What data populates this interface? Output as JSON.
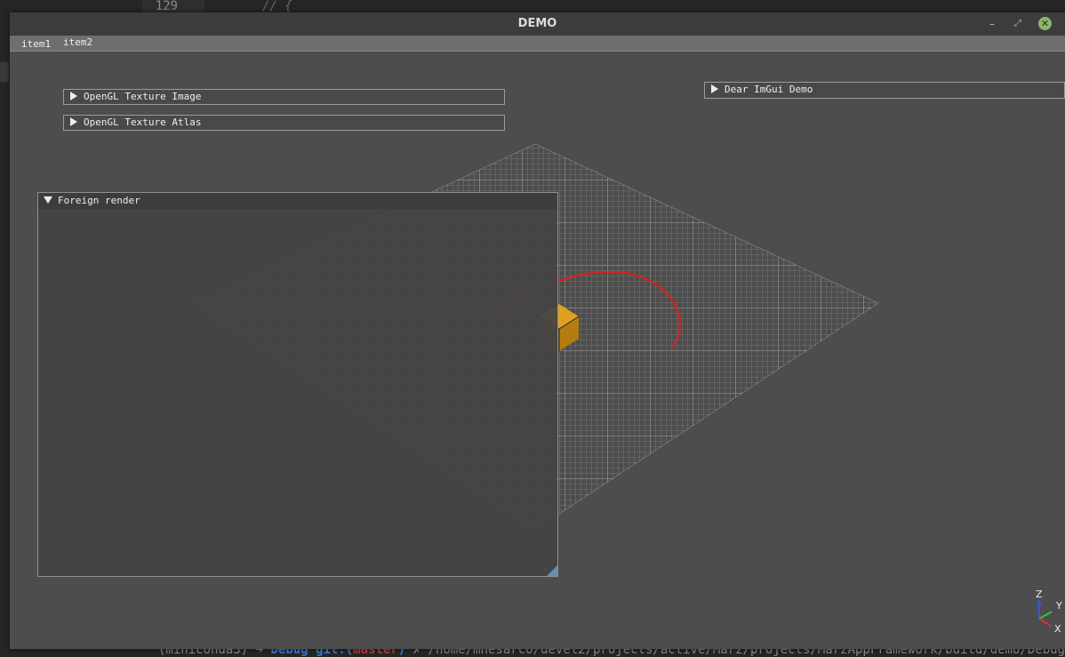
{
  "background": {
    "line_number": "129",
    "code_fragment": "//      {",
    "terminal": {
      "env": "(miniconda3)",
      "arrow": "➜",
      "dir": "Debug",
      "git_prefix": "git:(",
      "branch": "master",
      "git_suffix": ")",
      "dirty": "✗",
      "path": "/home/mnesarco/devel2/projects/active/Marz/projects/MarzAppFramework/build/demo/Debug/marz"
    }
  },
  "window": {
    "title": "DEMO",
    "minimize_glyph": "–",
    "maximize_glyph": "⤢",
    "close_glyph": "✕"
  },
  "menubar": {
    "items": [
      "item1",
      "item2"
    ]
  },
  "panels": {
    "texture_image": "OpenGL Texture Image",
    "texture_atlas": "OpenGL Texture Atlas",
    "imgui_demo": "Dear ImGui Demo",
    "foreign_render": "Foreign render"
  },
  "gizmo": {
    "z": "Z",
    "y": "Y",
    "x": "X"
  },
  "colors": {
    "annotation_arrow": "#d42323",
    "cube_top": "#e0a020",
    "cube_side": "#b57d10",
    "grid_line": "#e8e8e8",
    "axis_x": "#d43333",
    "axis_y": "#3ac33a",
    "axis_z": "#3355dd"
  },
  "icons": [
    "triangle-right-icon",
    "triangle-down-icon",
    "close-icon",
    "minimize-icon",
    "maximize-icon",
    "resize-grip-icon"
  ]
}
